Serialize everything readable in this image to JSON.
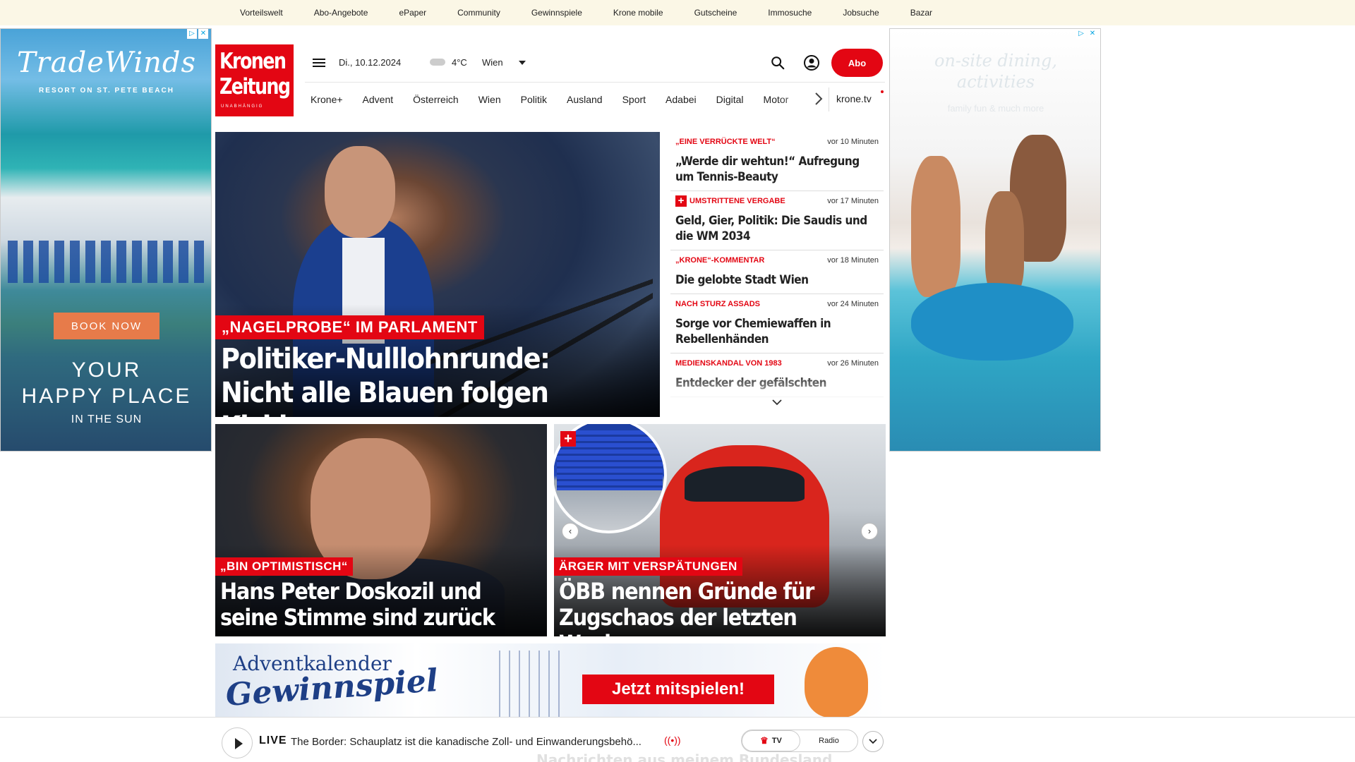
{
  "topbar": {
    "links": [
      "Vorteilswelt",
      "Abo-Angebote",
      "ePaper",
      "Community",
      "Gewinnspiele",
      "Krone mobile",
      "Gutscheine",
      "Immosuche",
      "Jobsuche",
      "Bazar"
    ]
  },
  "ad_left": {
    "brand": "TradeWinds",
    "brand_sub": "RESORT ON ST. PETE BEACH",
    "cta": "BOOK NOW",
    "slogan_line1": "YOUR",
    "slogan_line2": "HAPPY PLACE",
    "slogan_line3": "IN THE SUN"
  },
  "ad_right": {
    "faint_text_1": "on-site dining,",
    "faint_text_2": "activities",
    "faint_text_3": "family fun & much more"
  },
  "header": {
    "logo_line1": "Kronen",
    "logo_line2": "Zeitung",
    "logo_line3": "UNABHÄNGIG",
    "date": "Di., 10.12.2024",
    "temperature": "4°C",
    "city": "Wien",
    "abo_label": "Abo",
    "krone_tv": "krone.tv"
  },
  "nav": {
    "items": [
      "Krone+",
      "Advent",
      "Österreich",
      "Wien",
      "Politik",
      "Ausland",
      "Sport",
      "Adabei",
      "Digital",
      "Motor"
    ]
  },
  "hero": {
    "kicker": "„NAGELPROBE“ IM PARLAMENT",
    "title_line1": "Politiker-Nulllohnrunde:",
    "title_line2": "Nicht alle Blauen folgen Kickl"
  },
  "newslist": [
    {
      "category": "„Eine verrückte Welt“",
      "time": "vor 10 Minuten",
      "headline": "„Werde dir wehtun!“ Aufregung um Tennis-Beauty",
      "plus": false
    },
    {
      "category": "Umstrittene Vergabe",
      "time": "vor 17 Minuten",
      "headline": "Geld, Gier, Politik: Die Saudis und die WM 2034",
      "plus": true
    },
    {
      "category": "„Krone“-Kommentar",
      "time": "vor 18 Minuten",
      "headline": "Die gelobte Stadt Wien",
      "plus": false
    },
    {
      "category": "Nach Sturz Assads",
      "time": "vor 24 Minuten",
      "headline": "Sorge vor Chemiewaffen in Rebellenhänden",
      "plus": false
    },
    {
      "category": "Medienskandal von 1983",
      "time": "vor 26 Minuten",
      "headline": "Entdecker der gefälschten",
      "plus": false
    }
  ],
  "cards": [
    {
      "kicker": "„BIN OPTIMISTISCH“",
      "title_line1": "Hans Peter Doskozil und",
      "title_line2": "seine Stimme sind zurück"
    },
    {
      "kicker": "ÄRGER MIT VERSPÄTUNGEN",
      "title_line1": "ÖBB nennen Gründe für",
      "title_line2": "Zugschaos der letzten Wochen"
    }
  ],
  "card2_plus": "+",
  "advent": {
    "line1": "Adventkalender",
    "line2": "Gewinnspiel",
    "cta": "Jetzt mitspielen!"
  },
  "player": {
    "live_label": "LIVE",
    "live_text": "The Border: Schauplatz ist die kanadische Zoll- und Einwanderungsbehö...",
    "tv_label": "TV",
    "radio_label": "Radio",
    "underlying_text": "Nachrichten aus meinem Bundesland"
  },
  "colors": {
    "brand_red": "#e30613",
    "topbar_bg": "#fbf7e6"
  }
}
